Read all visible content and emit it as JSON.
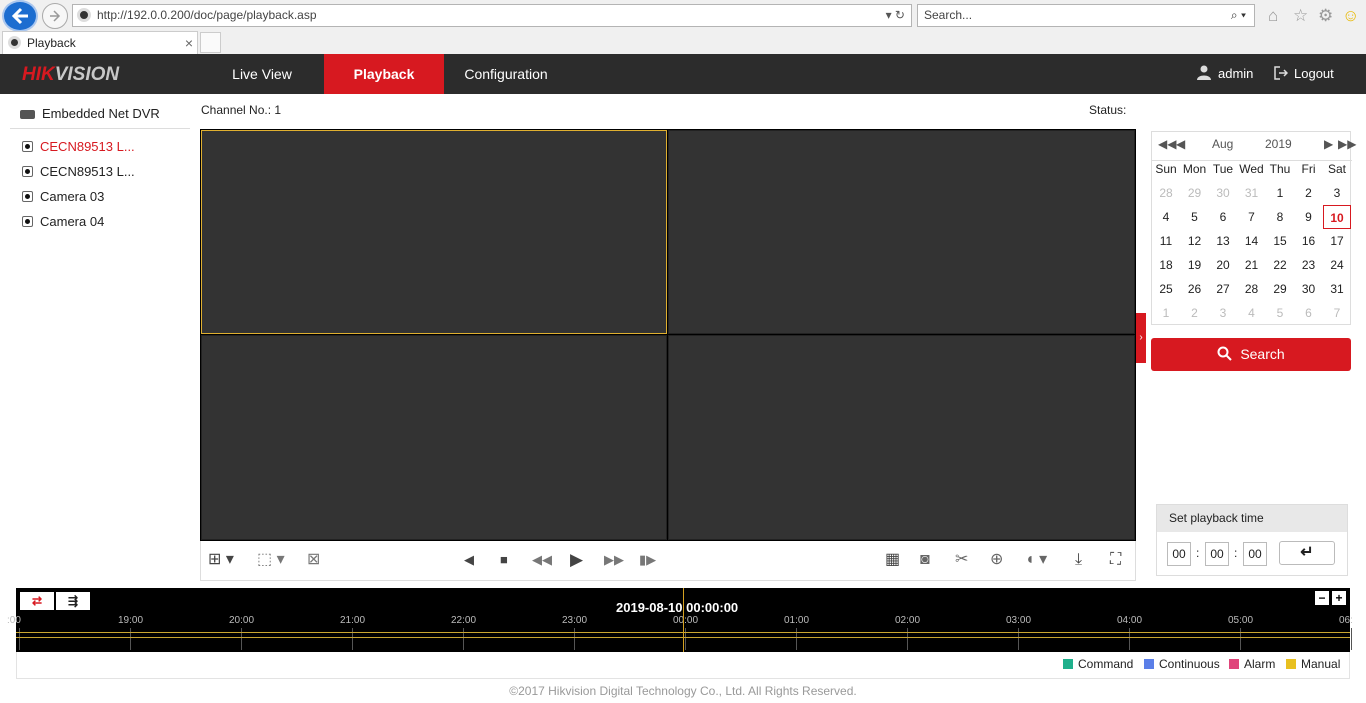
{
  "browser": {
    "url": "http://192.0.0.200/doc/page/playback.asp",
    "search_placeholder": "Search...",
    "tab_title": "Playback"
  },
  "header": {
    "logo_main": "HIK",
    "logo_accent": "VISION",
    "nav": [
      "Live View",
      "Playback",
      "Configuration"
    ],
    "user": "admin",
    "logout": "Logout"
  },
  "tree": {
    "device": "Embedded Net DVR",
    "cameras": [
      "CECN89513 L...",
      "CECN89513 L...",
      "Camera 03",
      "Camera 04"
    ]
  },
  "player": {
    "channel": "Channel No.: 1",
    "status": "Status:"
  },
  "calendar": {
    "month": "Aug",
    "year": "2019",
    "weekdays": [
      "Sun",
      "Mon",
      "Tue",
      "Wed",
      "Thu",
      "Fri",
      "Sat"
    ],
    "weeks": [
      [
        "28",
        "29",
        "30",
        "31",
        "1",
        "2",
        "3"
      ],
      [
        "4",
        "5",
        "6",
        "7",
        "8",
        "9",
        "10"
      ],
      [
        "11",
        "12",
        "13",
        "14",
        "15",
        "16",
        "17"
      ],
      [
        "18",
        "19",
        "20",
        "21",
        "22",
        "23",
        "24"
      ],
      [
        "25",
        "26",
        "27",
        "28",
        "29",
        "30",
        "31"
      ],
      [
        "1",
        "2",
        "3",
        "4",
        "5",
        "6",
        "7"
      ]
    ],
    "selected_day": "10",
    "search_label": "Search"
  },
  "playback_time": {
    "title": "Set playback time",
    "hour": "00",
    "minute": "00",
    "second": "00"
  },
  "timeline": {
    "datetime": "2019-08-10 00:00:00",
    "ticks": [
      ":00",
      "19:00",
      "20:00",
      "21:00",
      "22:00",
      "23:00",
      "00:00",
      "01:00",
      "02:00",
      "03:00",
      "04:00",
      "05:00",
      "06:"
    ],
    "legend": [
      {
        "label": "Command",
        "color": "#1fb08c"
      },
      {
        "label": "Continuous",
        "color": "#5b7fe8"
      },
      {
        "label": "Alarm",
        "color": "#e0457b"
      },
      {
        "label": "Manual",
        "color": "#e8c020"
      }
    ]
  },
  "footer": "©2017 Hikvision Digital Technology Co., Ltd. All Rights Reserved."
}
